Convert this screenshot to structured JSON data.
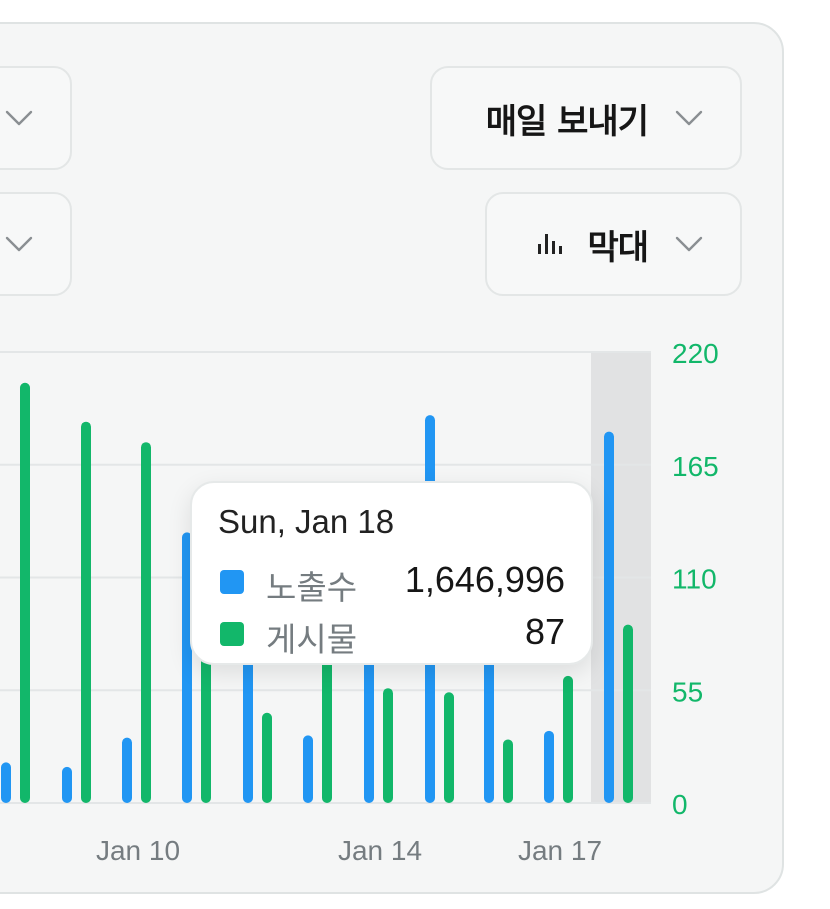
{
  "controls": {
    "send_label": "매일 보내기",
    "chart_type_label": "막대",
    "chart_type_icon": "bar-chart-icon",
    "chevron_icon": "chevron-down-icon"
  },
  "colors": {
    "impressions": "#2196f3",
    "posts": "#12b76a",
    "axis_right": "#12b76a",
    "highlight": "#e1e2e3",
    "grid": "#e3e6e7",
    "x_tick": "#757c80"
  },
  "chart_data": {
    "type": "bar",
    "x_tick_labels": [
      "Jan 10",
      "Jan 14",
      "Jan 17"
    ],
    "y2_ticks": [
      "0",
      "55",
      "110",
      "165",
      "220"
    ],
    "ylim_right": [
      0,
      220
    ],
    "ylim_left_relative": [
      0,
      2000000
    ],
    "highlighted": "Jan 18",
    "series": [
      {
        "name": "노출수",
        "axis": "left",
        "values": [
          180000,
          160000,
          290000,
          1200000,
          1350000,
          300000,
          1300000,
          1720000,
          1250000,
          320000,
          1646996
        ]
      },
      {
        "name": "게시물",
        "axis": "right",
        "values": [
          205,
          186,
          176,
          81,
          44,
          73,
          56,
          54,
          31,
          62,
          87
        ]
      }
    ],
    "grid": true
  },
  "tooltip": {
    "title": "Sun, Jan 18",
    "rows": [
      {
        "name": "노출수",
        "value": "1,646,996",
        "color": "#2196f3"
      },
      {
        "name": "게시물",
        "value": "87",
        "color": "#12b76a"
      }
    ]
  }
}
